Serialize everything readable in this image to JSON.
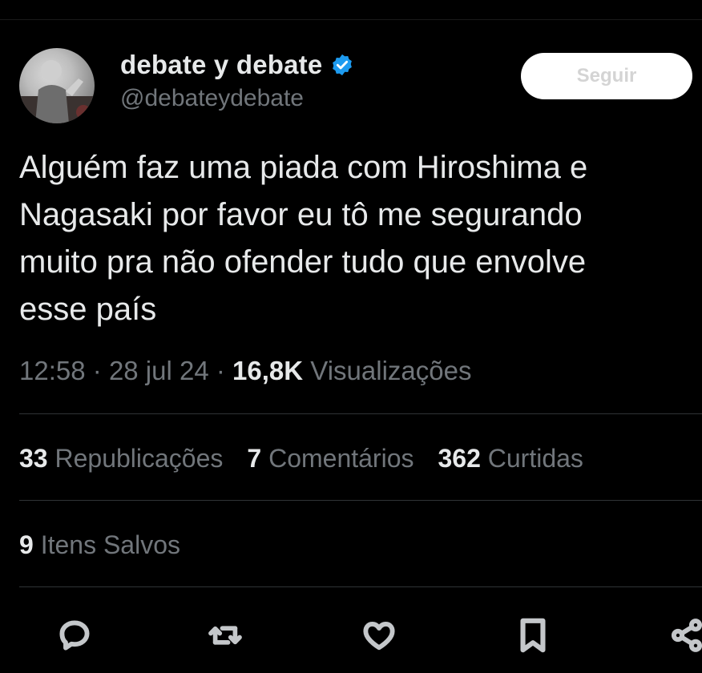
{
  "author": {
    "display_name": "debate y debate",
    "handle": "@debateydebate",
    "verified_color": "#1d9bf0"
  },
  "follow_button": {
    "label": "Seguir"
  },
  "tweet": {
    "text": "Alguém faz uma piada com Hiroshima e\nNagasaki por favor eu tô me segurando\nmuito pra não ofender tudo que envolve\nesse país",
    "time": "12:58",
    "date": "28 jul 24",
    "views_count": "16,8K",
    "views_label": "Visualizações"
  },
  "stats": {
    "reposts_count": "33",
    "reposts_label": "Republicações",
    "comments_count": "7",
    "comments_label": "Comentários",
    "likes_count": "362",
    "likes_label": "Curtidas",
    "saves_count": "9",
    "saves_label": "Itens Salvos"
  },
  "actions": [
    "reply-icon",
    "repost-icon",
    "like-icon",
    "bookmark-icon",
    "share-icon"
  ]
}
